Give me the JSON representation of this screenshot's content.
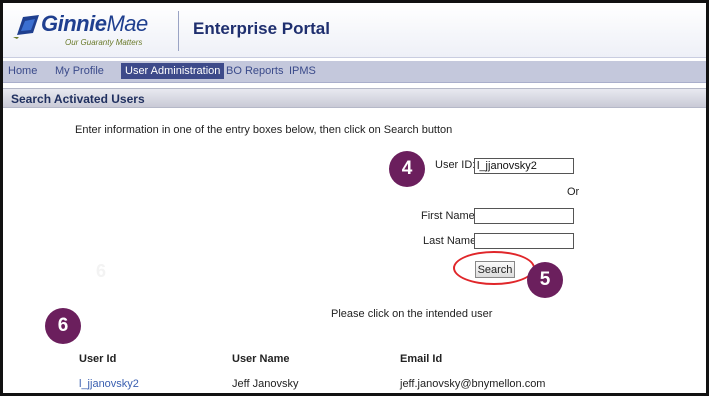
{
  "header": {
    "logo_name_bold": "Ginnie",
    "logo_name_light": "Mae",
    "logo_tagline": "Our Guaranty Matters",
    "portal_title": "Enterprise Portal"
  },
  "nav": {
    "items": [
      {
        "label": "Home",
        "active": false
      },
      {
        "label": "My Profile",
        "active": false
      },
      {
        "label": "User Administration",
        "active": true
      },
      {
        "label": "BO Reports",
        "active": false
      },
      {
        "label": "IPMS",
        "active": false
      }
    ]
  },
  "section": {
    "title": "Search Activated Users"
  },
  "instructions": "Enter information in one of the entry boxes below, then click on Search button",
  "form": {
    "user_id_label": "User ID:",
    "user_id_value": "l_jjanovsky2",
    "or_text": "Or",
    "first_name_label": "First Name:",
    "first_name_value": "",
    "last_name_label": "Last Name:",
    "last_name_value": "",
    "search_label": "Search"
  },
  "badges": {
    "step4": "4",
    "step5": "5",
    "step6": "6",
    "faint6": "6"
  },
  "results": {
    "prompt": "Please click on the intended user",
    "columns": [
      "User Id",
      "User Name",
      "Email Id"
    ],
    "rows": [
      {
        "user_id": "l_jjanovsky2",
        "user_name": "Jeff  Janovsky",
        "email": "jeff.janovsky@bnymellon.com"
      }
    ]
  },
  "colors": {
    "badge": "#6b1f5d",
    "nav_active": "#3d4a8a",
    "highlight_ring": "#e0262a",
    "link": "#3a5fb0"
  }
}
